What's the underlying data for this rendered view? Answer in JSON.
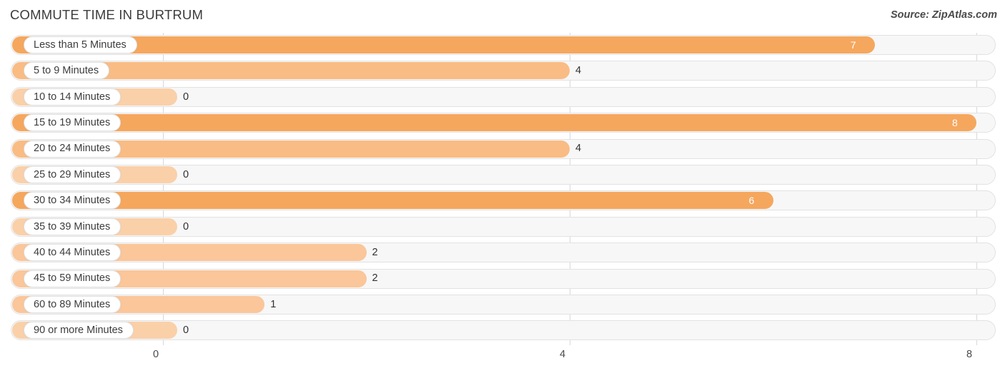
{
  "header": {
    "title": "COMMUTE TIME IN BURTRUM",
    "source": "Source: ZipAtlas.com"
  },
  "colors": {
    "bar_high": "#f5a75e",
    "bar_mid": "#f9bc84",
    "bar_low": "#fad0a9",
    "track": "#f7f7f7",
    "gridline": "#d8d8d8",
    "title": "#3b3b3b",
    "value_inside": "#ffffff",
    "value_outside": "#303030"
  },
  "chart_data": {
    "type": "bar",
    "orientation": "horizontal",
    "title": "COMMUTE TIME IN BURTRUM",
    "xlabel": "",
    "ylabel": "",
    "xlim": [
      0,
      8
    ],
    "grid": true,
    "legend": "none",
    "xticks": [
      "0",
      "4",
      "8"
    ],
    "xtick_values": [
      0,
      4,
      8
    ],
    "categories": [
      "Less than 5 Minutes",
      "5 to 9 Minutes",
      "10 to 14 Minutes",
      "15 to 19 Minutes",
      "20 to 24 Minutes",
      "25 to 29 Minutes",
      "30 to 34 Minutes",
      "35 to 39 Minutes",
      "40 to 44 Minutes",
      "45 to 59 Minutes",
      "60 to 89 Minutes",
      "90 or more Minutes"
    ],
    "values": [
      7,
      4,
      0,
      8,
      4,
      0,
      6,
      0,
      2,
      2,
      1,
      0
    ],
    "value_labels": [
      "7",
      "4",
      "0",
      "8",
      "4",
      "0",
      "6",
      "0",
      "2",
      "2",
      "1",
      "0"
    ]
  },
  "rows": [
    {
      "label": "Less than 5 Minutes",
      "value": 7,
      "value_label": "7",
      "inside": true,
      "color": "#f5a75e"
    },
    {
      "label": "5 to 9 Minutes",
      "value": 4,
      "value_label": "4",
      "inside": false,
      "color": "#f9bc84"
    },
    {
      "label": "10 to 14 Minutes",
      "value": 0,
      "value_label": "0",
      "inside": false,
      "color": "#fad0a9"
    },
    {
      "label": "15 to 19 Minutes",
      "value": 8,
      "value_label": "8",
      "inside": true,
      "color": "#f5a75e"
    },
    {
      "label": "20 to 24 Minutes",
      "value": 4,
      "value_label": "4",
      "inside": false,
      "color": "#f9bc84"
    },
    {
      "label": "25 to 29 Minutes",
      "value": 0,
      "value_label": "0",
      "inside": false,
      "color": "#fad0a9"
    },
    {
      "label": "30 to 34 Minutes",
      "value": 6,
      "value_label": "6",
      "inside": true,
      "color": "#f5a75e"
    },
    {
      "label": "35 to 39 Minutes",
      "value": 0,
      "value_label": "0",
      "inside": false,
      "color": "#fad0a9"
    },
    {
      "label": "40 to 44 Minutes",
      "value": 2,
      "value_label": "2",
      "inside": false,
      "color": "#fac69a"
    },
    {
      "label": "45 to 59 Minutes",
      "value": 2,
      "value_label": "2",
      "inside": false,
      "color": "#fac69a"
    },
    {
      "label": "60 to 89 Minutes",
      "value": 1,
      "value_label": "1",
      "inside": false,
      "color": "#fac69a"
    },
    {
      "label": "90 or more Minutes",
      "value": 0,
      "value_label": "0",
      "inside": false,
      "color": "#fad0a9"
    }
  ],
  "axis": {
    "ticks": [
      {
        "label": "0",
        "value": 0
      },
      {
        "label": "4",
        "value": 4
      },
      {
        "label": "8",
        "value": 8
      }
    ]
  }
}
